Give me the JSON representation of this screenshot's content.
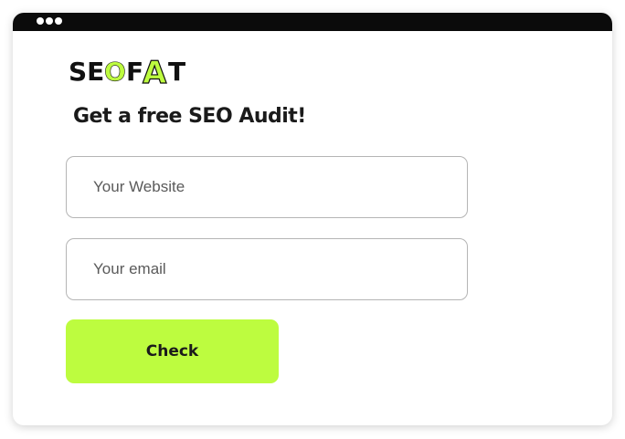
{
  "window": {
    "titlebar_dots": 3
  },
  "logo": {
    "text_part1": "SE",
    "text_o": "O",
    "text_f": "F",
    "text_a": "A",
    "text_t": "T",
    "accent_color": "#bdfc3f",
    "text_color": "#111111"
  },
  "form": {
    "heading": "Get a free SEO Audit!",
    "website_placeholder": "Your Website",
    "email_placeholder": "Your email",
    "submit_label": "Check",
    "button_color": "#bdfc3f"
  }
}
